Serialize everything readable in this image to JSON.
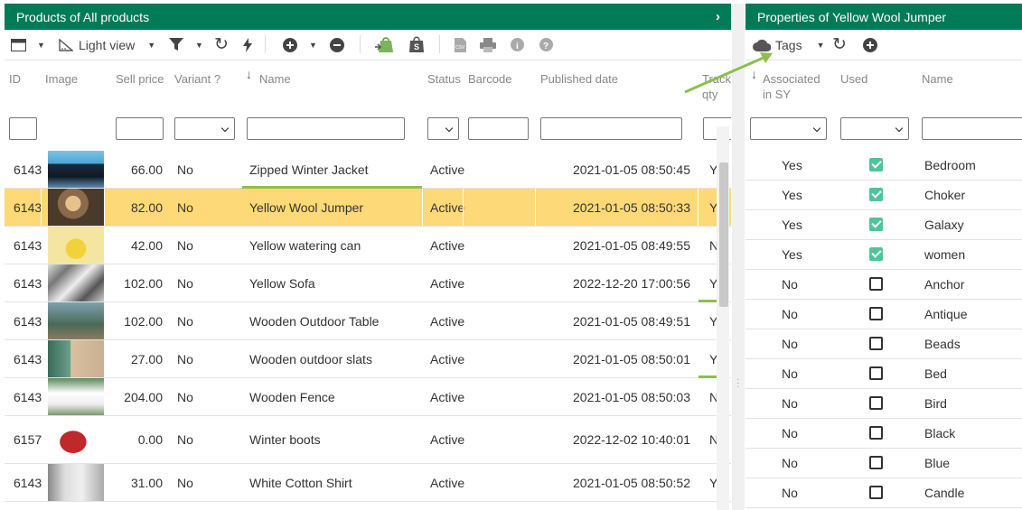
{
  "left_panel": {
    "title": "Products of All products",
    "toolbar": {
      "view_label": "Light view"
    },
    "columns": {
      "id": "ID",
      "image": "Image",
      "sell_price": "Sell price",
      "variant": "Variant ?",
      "name": "Name",
      "status": "Status",
      "barcode": "Barcode",
      "published_date": "Published date",
      "track_qty_1": "Track",
      "track_qty_2": "qty"
    },
    "rows": [
      {
        "id": "6143",
        "price": "66.00",
        "variant": "No",
        "name": "Zipped Winter Jacket",
        "status": "Active",
        "published": "2021-01-05 08:50:45",
        "track": "Y"
      },
      {
        "id": "6143",
        "price": "82.00",
        "variant": "No",
        "name": "Yellow Wool Jumper",
        "status": "Active",
        "published": "2021-01-05 08:50:33",
        "track": "Y"
      },
      {
        "id": "6143",
        "price": "42.00",
        "variant": "No",
        "name": "Yellow watering can",
        "status": "Active",
        "published": "2021-01-05 08:49:55",
        "track": "N"
      },
      {
        "id": "6143",
        "price": "102.00",
        "variant": "No",
        "name": "Yellow Sofa",
        "status": "Active",
        "published": "2022-12-20 17:00:56",
        "track": "Y"
      },
      {
        "id": "6143",
        "price": "102.00",
        "variant": "No",
        "name": "Wooden Outdoor Table",
        "status": "Active",
        "published": "2021-01-05 08:49:51",
        "track": "Y"
      },
      {
        "id": "6143",
        "price": "27.00",
        "variant": "No",
        "name": "Wooden outdoor slats",
        "status": "Active",
        "published": "2021-01-05 08:50:01",
        "track": "Y"
      },
      {
        "id": "6143",
        "price": "204.00",
        "variant": "No",
        "name": "Wooden Fence",
        "status": "Active",
        "published": "2021-01-05 08:50:03",
        "track": "N"
      },
      {
        "id": "6157",
        "price": "0.00",
        "variant": "No",
        "name": "Winter boots",
        "status": "Active",
        "published": "2022-12-02 10:40:01",
        "track": "N"
      },
      {
        "id": "6143",
        "price": "31.00",
        "variant": "No",
        "name": "White Cotton Shirt",
        "status": "Active",
        "published": "2021-01-05 08:50:52",
        "track": "Y"
      }
    ]
  },
  "right_panel": {
    "title": "Properties of Yellow Wool Jumper",
    "toolbar": {
      "tags_label": "Tags"
    },
    "columns": {
      "assoc_1": "Associated",
      "assoc_2": "in SY",
      "used": "Used",
      "name": "Name"
    },
    "rows": [
      {
        "assoc": "Yes",
        "used": true,
        "name": "Bedroom"
      },
      {
        "assoc": "Yes",
        "used": true,
        "name": "Choker"
      },
      {
        "assoc": "Yes",
        "used": true,
        "name": "Galaxy"
      },
      {
        "assoc": "Yes",
        "used": true,
        "name": "women"
      },
      {
        "assoc": "No",
        "used": false,
        "name": "Anchor"
      },
      {
        "assoc": "No",
        "used": false,
        "name": "Antique"
      },
      {
        "assoc": "No",
        "used": false,
        "name": "Beads"
      },
      {
        "assoc": "No",
        "used": false,
        "name": "Bed"
      },
      {
        "assoc": "No",
        "used": false,
        "name": "Bird"
      },
      {
        "assoc": "No",
        "used": false,
        "name": "Black"
      },
      {
        "assoc": "No",
        "used": false,
        "name": "Blue"
      },
      {
        "assoc": "No",
        "used": false,
        "name": "Candle"
      }
    ]
  },
  "colors": {
    "header_green": "#007a57",
    "selected_row": "#fdd977",
    "check_green": "#4fc49b",
    "annotation_arrow": "#8cbf4f"
  }
}
